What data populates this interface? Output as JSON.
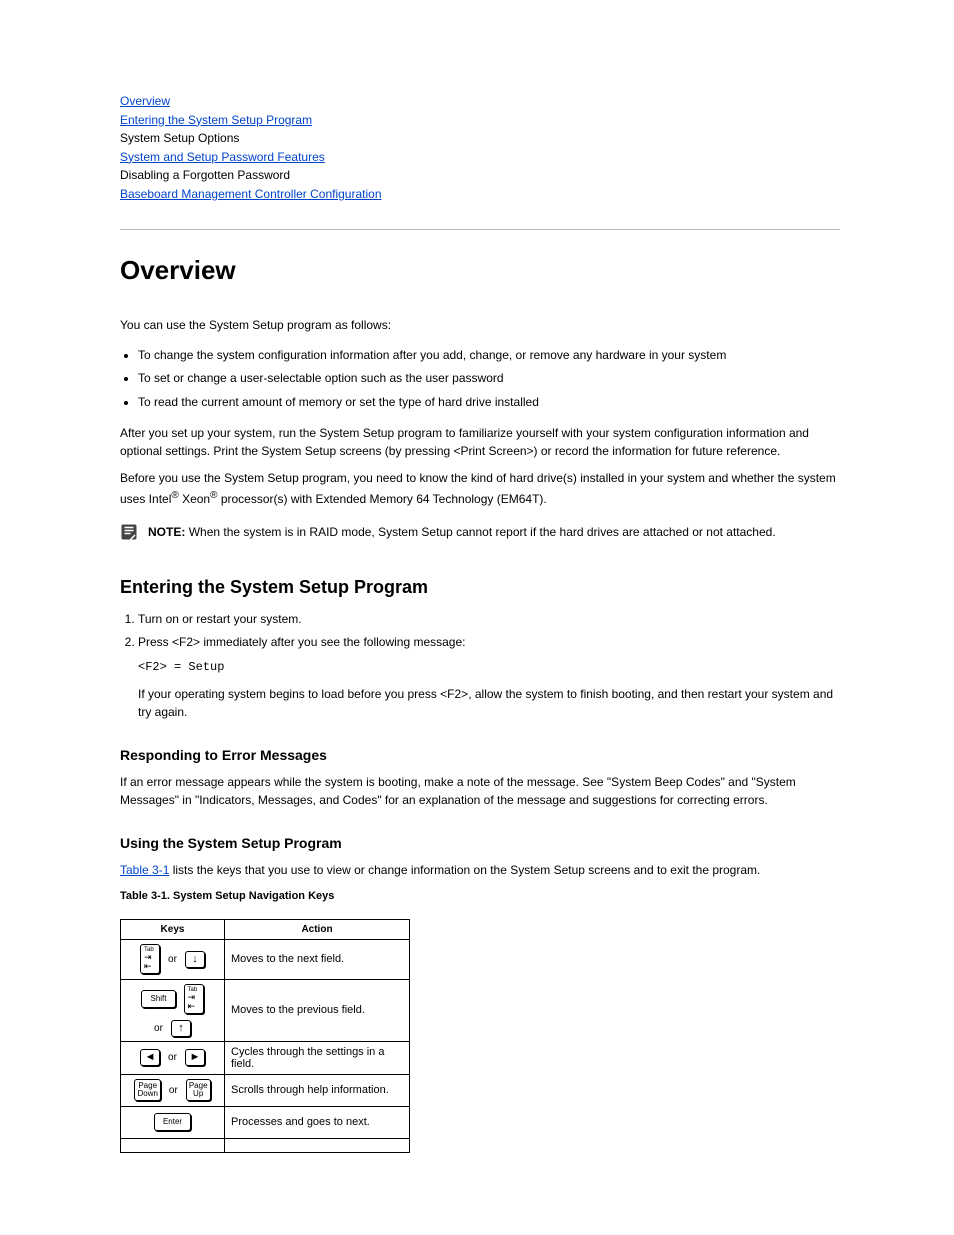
{
  "toc": [
    {
      "label": "Overview",
      "href": "#"
    },
    {
      "label": "Entering the System Setup Program",
      "href": "#"
    },
    {
      "label": "System Setup Options",
      "href": "#"
    },
    {
      "label": "System and Setup Password Features",
      "href": "#"
    },
    {
      "label": "Disabling a Forgotten Password",
      "href": "#"
    },
    {
      "label": "Baseboard Management Controller Configuration",
      "href": "#"
    }
  ],
  "toc_link_index_a": 3,
  "toc_link_index_b": 5,
  "section_title": "Overview",
  "p1a": "You can use the System Setup program as follows:",
  "feat": [
    "To change the system configuration information after you add, change, or remove any hardware in your system",
    "To set or change a user-selectable option such as the user password",
    "To read the current amount of memory or set the type of hard drive installed"
  ],
  "p1b_a": "After you set up your system, run the System Setup program to familiarize yourself with your system configuration information and optional settings. Print the System Setup screens (by pressing <Print Screen>) or record the information for future reference.",
  "p1c_a": "Before you use the System Setup program, you need to know the kind of hard drive(s) installed in your system and whether the system uses Intel",
  "p1c_reg1": "®",
  "p1c_b": " Xeon",
  "p1c_reg2": "®",
  "p1c_c": " processor(s) with Extended Memory 64 Technology (EM64T).",
  "note_label": "NOTE:",
  "note_text": "When the system is in RAID mode, System Setup cannot report if the hard drives are attached or not attached.",
  "h3_enter": "Entering the System Setup Program",
  "ol": [
    {
      "t": "Turn on or restart your system."
    },
    {
      "t": "Press <F2> immediately after you see the following message:",
      "code": "<F2> = Setup",
      "after": "If your operating system begins to load before you press <F2>, allow the system to finish booting, and then restart your system and try again."
    }
  ],
  "h3_err": "Responding to Error Messages",
  "p_err": "If an error message appears while the system is booting, make a note of the message. See \"System Beep Codes\" and \"System Messages\" in \"Indicators, Messages, and Codes\" for an explanation of the message and suggestions for correcting errors.",
  "h3_use": "Using the System Setup Program",
  "p_use": " lists the keys that you use to view or change information on the System Setup screens and to exit the program.",
  "tbl_link": "Table 3-1",
  "tbl_caption": "Table 3-1. System Setup Navigation Keys",
  "tbl_hdr_keys": "Keys",
  "tbl_hdr_action": "Action",
  "tbl_rows": [
    {
      "action": "Moves to the next field."
    },
    {
      "action": "Moves to the previous field."
    },
    {
      "action": "Cycles through the settings in a field."
    },
    {
      "action": "Scrolls through help information."
    },
    {
      "action": "Processes and goes to next."
    }
  ],
  "or": "or",
  "key_tab": "Tab",
  "key_shift": "Shift",
  "key_enter": "Enter",
  "key_pgdn_a": "Page",
  "key_pgdn_b": "Down",
  "key_pgup_a": "Page",
  "key_pgup_b": "Up"
}
